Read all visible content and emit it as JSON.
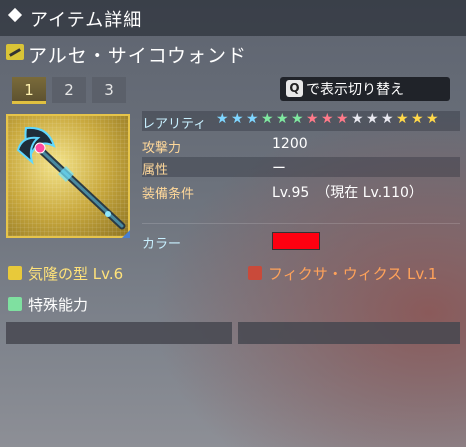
{
  "header": {
    "title": "アイテム詳細"
  },
  "item": {
    "name": "アルセ・サイコウォンド"
  },
  "tabs": [
    {
      "label": "1"
    },
    {
      "label": "2"
    },
    {
      "label": "3"
    }
  ],
  "toggle": {
    "key": "Q",
    "label": "で表示切り替え"
  },
  "stats": {
    "rarity_label": "レアリティ",
    "rarity_stars": 15,
    "star_colors": [
      "#7fd6ff",
      "#7fd6ff",
      "#7fd6ff",
      "#7fe8a0",
      "#7fe8a0",
      "#7fe8a0",
      "#ff7a8a",
      "#ff7a8a",
      "#ff7a8a",
      "#e8e8f0",
      "#e8e8f0",
      "#e8e8f0",
      "#ffd84a",
      "#ffd84a",
      "#ffd84a"
    ],
    "attack_label": "攻撃力",
    "attack_value": "1200",
    "element_label": "属性",
    "element_value": "ー",
    "requirement_label": "装備条件",
    "requirement_value": "Lv.95　（現在 Lv.110）",
    "color_label": "カラー",
    "color_value": "#ff0010"
  },
  "potential": {
    "label": "気隆の型 Lv.6",
    "icon_color": "#e8c93a"
  },
  "fixa": {
    "label": "フィクサ・ウィクス Lv.1",
    "icon_color": "#c94a3a"
  },
  "special": {
    "label": "特殊能力",
    "icon_color": "#7fe0a0"
  }
}
